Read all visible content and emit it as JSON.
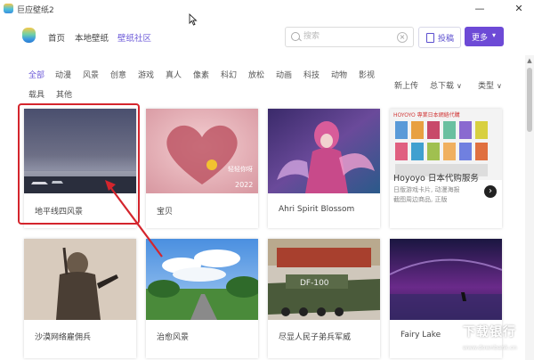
{
  "window": {
    "title": "巨应壁纸2",
    "min": "—",
    "close": "✕"
  },
  "nav": {
    "home": "首页",
    "local": "本地壁纸",
    "community": "壁纸社区"
  },
  "search": {
    "placeholder": "搜索",
    "submit_label": "投稿",
    "more_label": "更多",
    "more_chev": "▾"
  },
  "categories": [
    "全部",
    "动漫",
    "风景",
    "创意",
    "游戏",
    "真人",
    "像素",
    "科幻",
    "放松",
    "动画",
    "科技",
    "动物",
    "影视",
    "载具",
    "其他"
  ],
  "sort": {
    "newest": "新上传",
    "downloads": "总下载",
    "type": "类型",
    "chev": "∨"
  },
  "cards": [
    {
      "caption": "地平线四风景"
    },
    {
      "caption": "宝贝"
    },
    {
      "caption": "Ahri Spirit Blossom"
    },
    {
      "caption": "Hoyoyo 日本代购服务",
      "ad_header": "HOYOYO 專業日本網絡代購",
      "ad_sub1": "日版游戏卡片, 动漫海报",
      "ad_sub2": "截图周边商品, 正版",
      "ad_arrow": "›"
    },
    {
      "caption": "沙漠网络雇佣兵"
    },
    {
      "caption": "治愈风景"
    },
    {
      "caption": "尽显人民子弟兵军威"
    },
    {
      "caption": "Fairy Lake"
    }
  ],
  "thumb_text": {
    "heart_sign": "轻轻你呀",
    "heart_year": "2022",
    "tank_plate": "DF-100"
  },
  "watermark": {
    "title": "下载银行",
    "url": "www.downbank.cn"
  },
  "colors": {
    "accent": "#6c5ad8",
    "more_button": "#6d4ad6",
    "highlight": "#d4252d"
  }
}
